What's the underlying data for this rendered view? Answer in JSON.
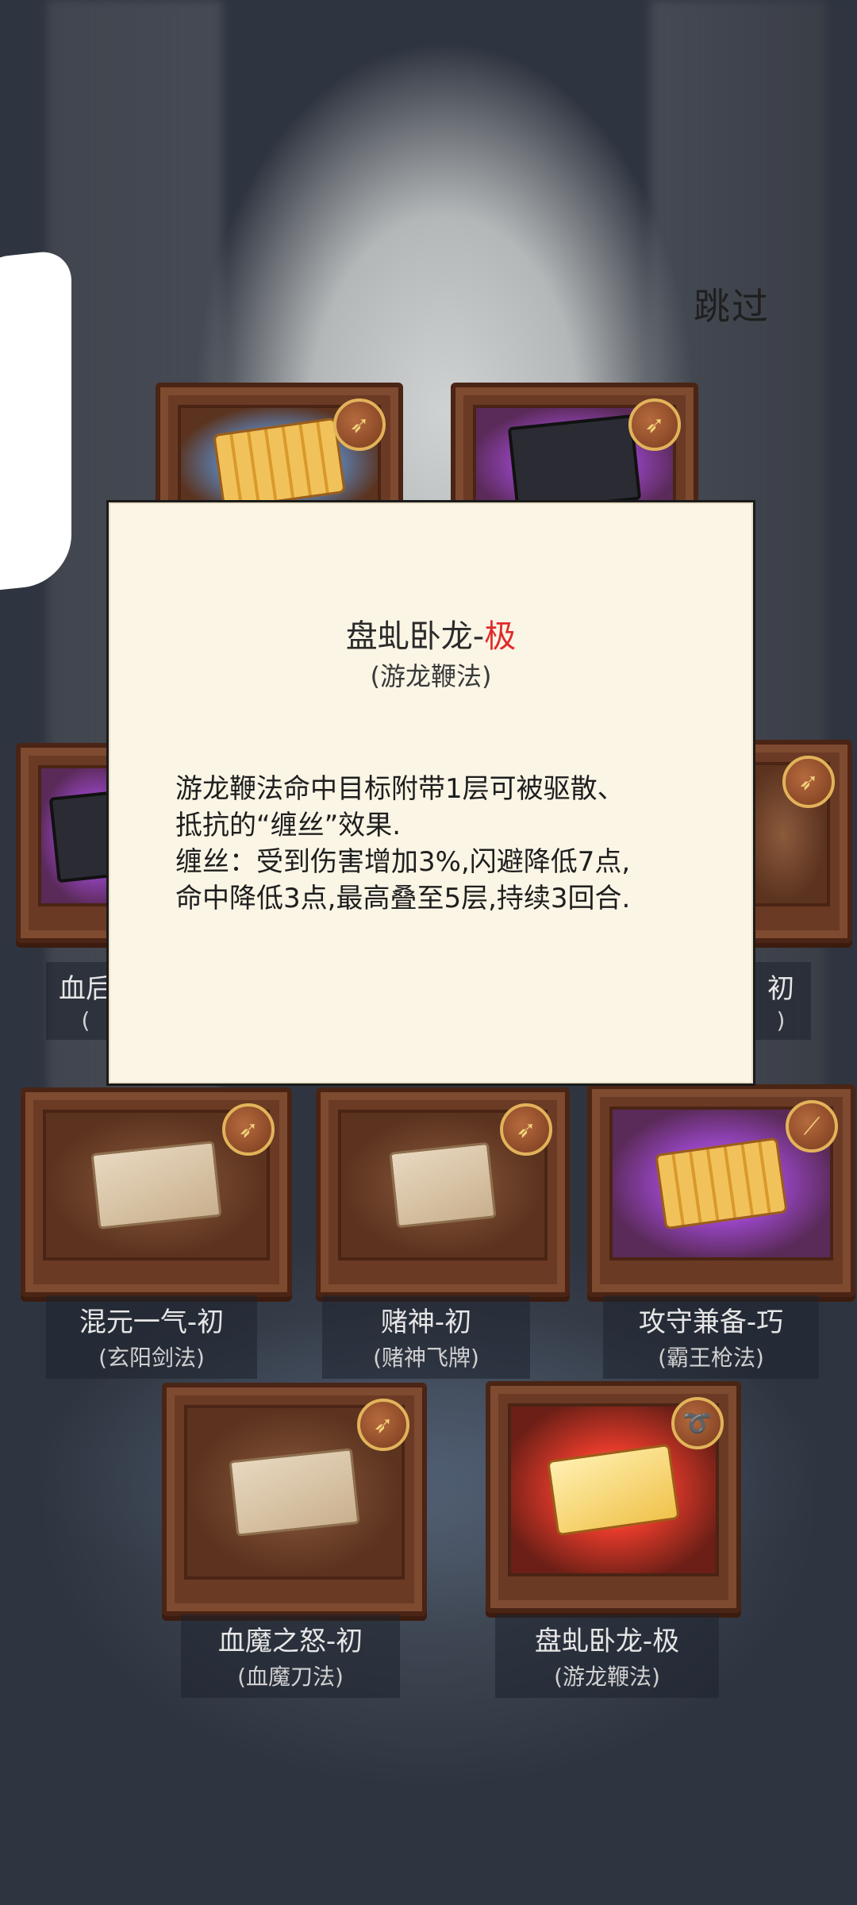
{
  "header": {
    "skip_label": "跳过"
  },
  "modal": {
    "title_name": "盘虬卧龙-",
    "title_grade": "极",
    "subtitle": "(游龙鞭法)",
    "description_lines": [
      "游龙鞭法命中目标附带1层可被驱散、",
      "抵抗的“缠丝”效果.",
      "缠丝：受到伤害增加3%,闪避降低7点,",
      "命中降低3点,最高叠至5层,持续3回合."
    ]
  },
  "rewards": [
    {
      "name": "血魔之...",
      "sub": "(...)",
      "partial_left": "血后",
      "partial_left_sub": "("
    },
    {
      "name": "...-初",
      "sub": "...)",
      "partial_right": "初",
      "partial_right_sub": ")"
    },
    {
      "name": "混元一气-初",
      "sub": "(玄阳剑法)"
    },
    {
      "name": "赌神-初",
      "sub": "(赌神飞牌)"
    },
    {
      "name": "攻守兼备-巧",
      "sub": "(霸王枪法)"
    },
    {
      "name": "血魔之怒-初",
      "sub": "(血魔刀法)"
    },
    {
      "name": "盘虬卧龙-极",
      "sub": "(游龙鞭法)"
    }
  ],
  "icons": {
    "badge_blade": "blade-icon",
    "badge_whip": "whip-icon",
    "badge_spear": "spear-icon"
  }
}
